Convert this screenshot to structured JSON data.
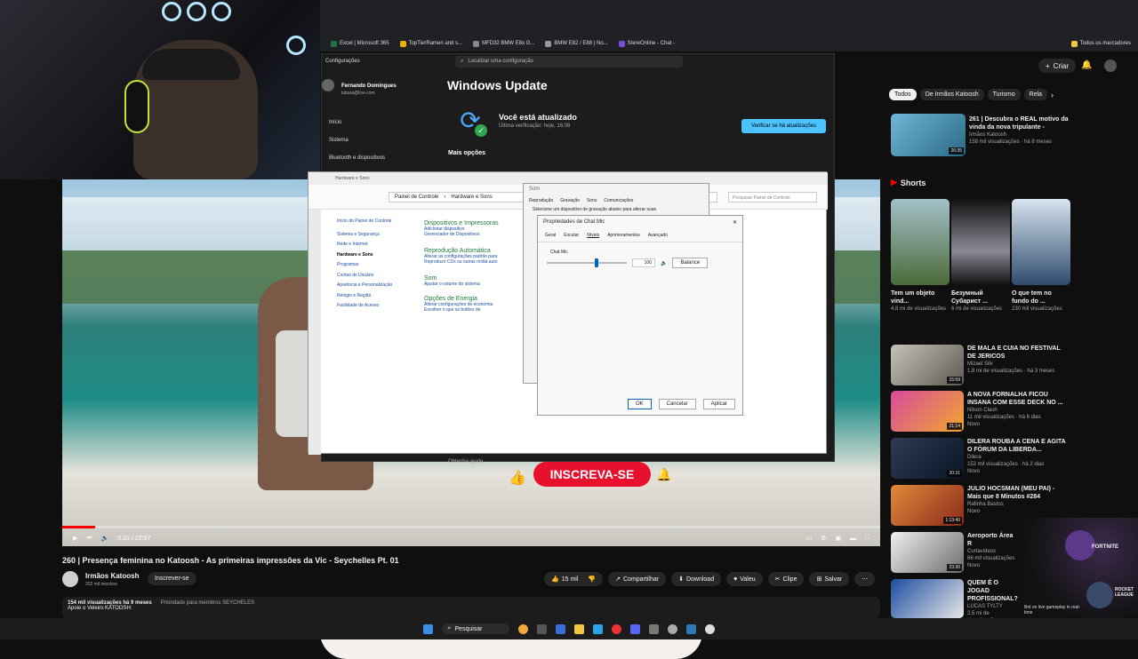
{
  "browser": {
    "bookmarks": [
      "Excel | Microsoft 365",
      "TopTierRamen and s...",
      "MFD32 BMW E8x G...",
      "BMW E82 / E88 | No...",
      "StereOnline - Chat -"
    ],
    "all_bookmarks": "Todos os marcadores"
  },
  "settings": {
    "app_title": "Configurações",
    "search_placeholder": "Localizar uma configuração",
    "user_name": "Fernando Domingues",
    "user_email": "tubara@live.com",
    "nav": [
      "Início",
      "Sistema",
      "Bluetooth e dispositivos"
    ],
    "page_title": "Windows Update",
    "status": "Você está atualizado",
    "last_check": "Última verificação: hoje, 16:08",
    "check_button": "Verificar se há atualizações",
    "more_options": "Mais opções",
    "bottom_text": "Obtenha ajuda"
  },
  "control_panel": {
    "title": "Hardware e Sons",
    "breadcrumb": [
      "Painel de Controle",
      "Hardware e Sons"
    ],
    "search_placeholder": "Pesquisar Painel de Controle",
    "side_nav": [
      "Início do Painel de Controle",
      "Sistema e Segurança",
      "Rede e Internet",
      "Hardware e Sons",
      "Programas",
      "Contas de Usuário",
      "Aparência e Personalização",
      "Relógio e Região",
      "Facilidade de Acesso"
    ],
    "sections": [
      {
        "title": "Dispositivos e Impressoras",
        "links": [
          "Adicionar dispositivo",
          "Gerenciador de Dispositivos"
        ]
      },
      {
        "title": "Reprodução Automática",
        "links": [
          "Alterar as configurações padrão para",
          "Reproduzir CDs ou outras mídia auto"
        ]
      },
      {
        "title": "Som",
        "links": [
          "Ajustar o volume do sistema"
        ]
      },
      {
        "title": "Opções de Energia",
        "links": [
          "Alterar configurações de economia",
          "Escolher o que os botões de"
        ]
      }
    ]
  },
  "sound_dialog": {
    "title": "Som",
    "tabs": [
      "Reprodução",
      "Gravação",
      "Sons",
      "Comunicações"
    ],
    "instruction": "Selecione um dispositivo de gravação abaixo para alterar suas"
  },
  "props_dialog": {
    "title": "Propriedades de Chat Mic",
    "tabs": [
      "Geral",
      "Escutar",
      "Níveis",
      "Aprimoramentos",
      "Avançado"
    ],
    "level_label": "Chat Mic",
    "level_value": "100",
    "level_fraction": 0.6,
    "balance_button": "Balance",
    "ok": "OK",
    "cancel": "Cancelar",
    "apply": "Aplicar"
  },
  "video": {
    "title": "260 | Presença feminina no Katoosh - As primeiras impressões da Vic - Seychelles Pt. 01",
    "time": "0:31 / 22:57",
    "progress_fraction": 0.04,
    "subscribe_overlay": "INSCREVA-SE",
    "channel": "Irmãos Katoosh",
    "subscribers": "332 mil inscritos",
    "subscribe_button": "Inscrever-se",
    "likes": "15 mil",
    "share": "Compartilhar",
    "download": "Download",
    "thanks": "Valeu",
    "clip": "Clipe",
    "save": "Salvar",
    "views_line": "154 mil visualizações  há 9 meses",
    "tags_line": "Prioridade para membros  SEYCHELES",
    "support_line": "Apoie o Veleiro KATOOSH:"
  },
  "youtube": {
    "create": "Criar",
    "chips": [
      "Todos",
      "De Irmãos Katoosh",
      "Turismo",
      "Rela"
    ],
    "shorts_header": "Shorts",
    "top_rec": {
      "title": "261 | Descubra o REAL motivo da vinda da nova tripulante -",
      "channel": "Irmãos Katoosh",
      "meta": "158 mil visualizações · há 8 meses",
      "duration": "26:35"
    },
    "shorts": [
      {
        "title": "Tem um objeto vind...",
        "meta": "4,8 mi de visualizações"
      },
      {
        "title": "Безумный Субарист ...",
        "meta": "6 mi de visualizações"
      },
      {
        "title": "O que tem no fundo do ...",
        "meta": "230 mil visualizações"
      }
    ],
    "recs": [
      {
        "title": "DE MALA E CUIA NO FESTIVAL DE JERICOS",
        "channel": "Mizael Silv",
        "meta": "1,8 mi de visualizações · há 3 meses",
        "duration": "15:59"
      },
      {
        "title": "A NOVA FORNALHA FICOU INSANA COM ESSE DECK NO ...",
        "channel": "Nilson Clash",
        "meta": "11 mil visualizações · há 6 dias",
        "badge": "Novo",
        "duration": "21:14"
      },
      {
        "title": "DILERA ROUBA A CENA E AGITA O FÓRUM DA LIBERDA...",
        "channel": "Dilera",
        "meta": "152 mil visualizações · há 2 dias",
        "badge": "Novo",
        "duration": "20:31"
      },
      {
        "title": "JULIO HOCSMAN (MEU PAI) - Mais que 8 Minutos #284",
        "channel": "Rafinha Bastos",
        "meta": "",
        "badge": "Novo",
        "duration": "1:13:40"
      },
      {
        "title": "Aeroporto Área R",
        "channel": "Curtavideos",
        "meta": "66 mil visualizações",
        "badge": "Novo",
        "duration": "23:30"
      },
      {
        "title": "QUEM É O JOGAD PROFISSIONAL?",
        "channel": "LUCAS TYLTY",
        "meta": "2,5 mi de visualizações",
        "duration": ""
      }
    ]
  },
  "stream_overlay": {
    "labels": [
      "FORTNITE",
      "ROCKET LEAGUE"
    ],
    "caption": "Bot on live gameplay in real-time"
  },
  "taskbar": {
    "search": "Pesquisar"
  }
}
